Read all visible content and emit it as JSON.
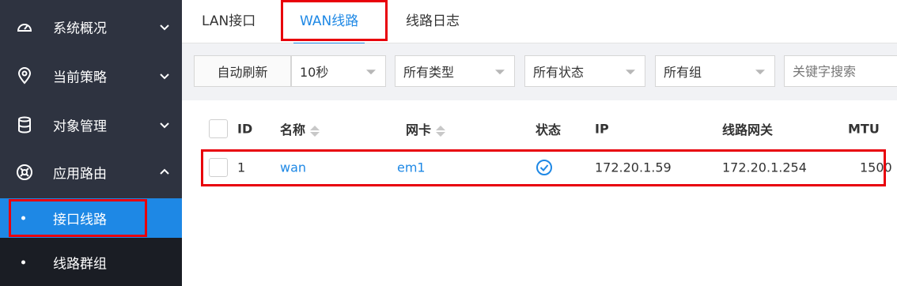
{
  "sidebar": {
    "items": [
      {
        "label": "系统概况",
        "icon": "gauge-icon",
        "expanded": false
      },
      {
        "label": "当前策略",
        "icon": "location-pin-icon",
        "expanded": false
      },
      {
        "label": "对象管理",
        "icon": "database-icon",
        "expanded": false
      },
      {
        "label": "应用路由",
        "icon": "route-compass-icon",
        "expanded": true
      }
    ],
    "subitems": [
      {
        "label": "接口线路",
        "active": true
      },
      {
        "label": "线路群组",
        "active": false
      }
    ]
  },
  "tabs": [
    {
      "label": "LAN接口",
      "active": false
    },
    {
      "label": "WAN线路",
      "active": true
    },
    {
      "label": "线路日志",
      "active": false
    }
  ],
  "toolbar": {
    "refresh_label": "自动刷新",
    "interval": "10秒",
    "type_filter": "所有类型",
    "status_filter": "所有状态",
    "group_filter": "所有组",
    "search_placeholder": "关键字搜索"
  },
  "table": {
    "columns": [
      "ID",
      "名称",
      "网卡",
      "状态",
      "IP",
      "线路网关",
      "MTU"
    ],
    "rows": [
      {
        "id": "1",
        "name": "wan",
        "nic": "em1",
        "status": "ok",
        "ip": "172.20.1.59",
        "gateway": "172.20.1.254",
        "mtu": "1500"
      }
    ]
  },
  "colors": {
    "accent": "#1e88e5",
    "highlight": "#e8000b",
    "sidebar_bg": "#2e3340"
  }
}
